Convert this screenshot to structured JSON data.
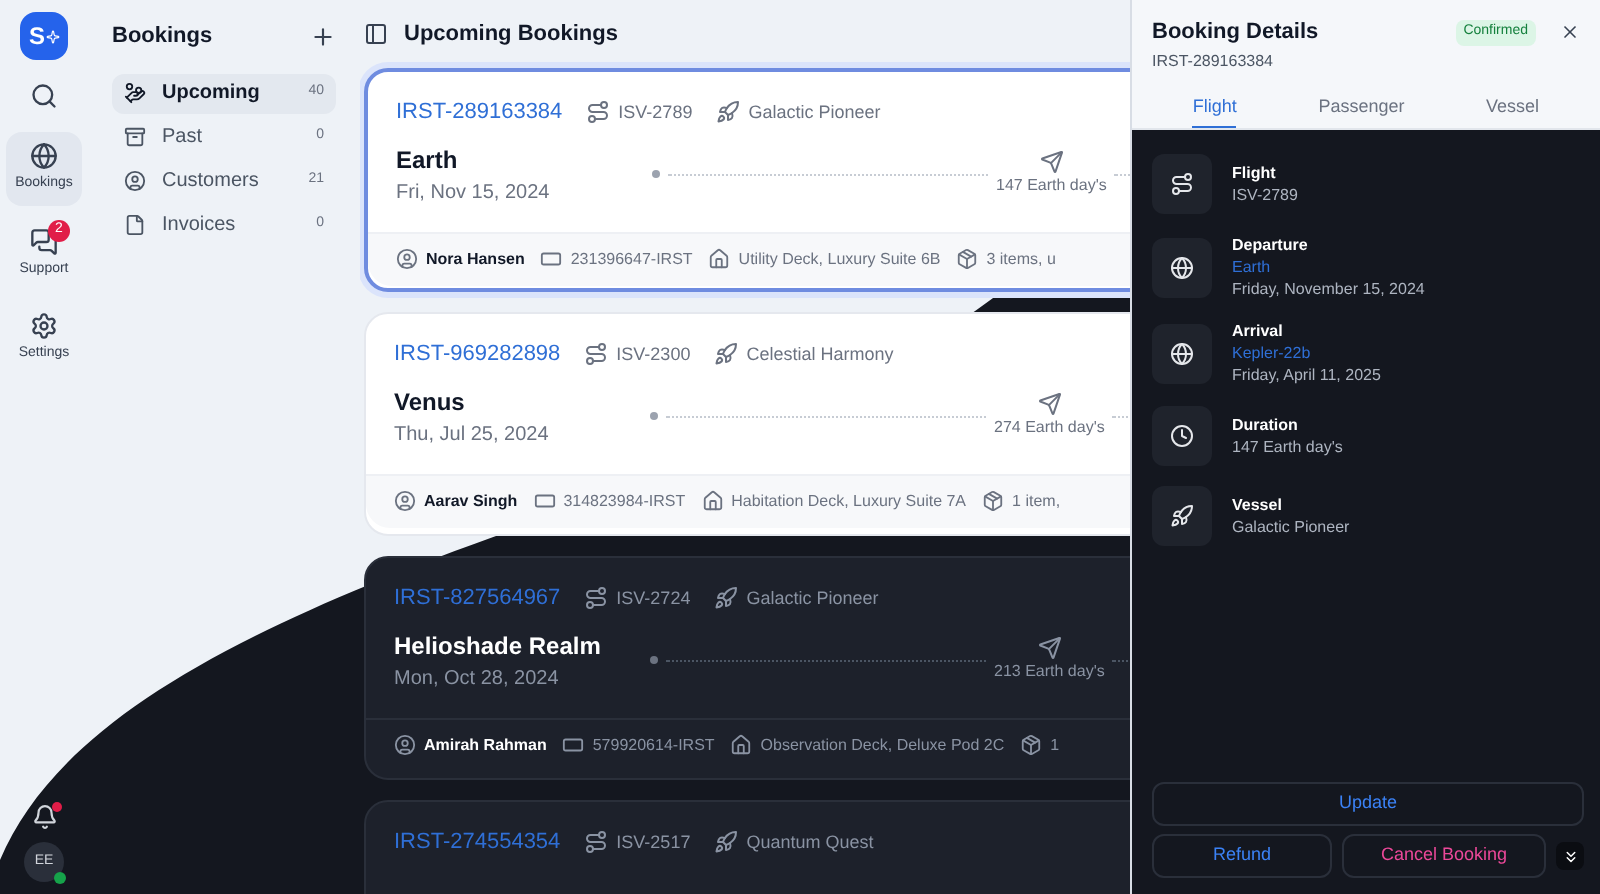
{
  "rail": {
    "logo": "S",
    "items": [
      {
        "kind": "search",
        "selected": false
      },
      {
        "label": "Bookings",
        "kind": "globe",
        "selected": true
      },
      {
        "label": "Support",
        "kind": "chat",
        "selected": false,
        "badge": "2"
      },
      {
        "label": "Settings",
        "kind": "gear",
        "selected": false
      }
    ],
    "avatar": "EE"
  },
  "bookings_panel": {
    "title": "Bookings",
    "items": [
      {
        "label": "Upcoming",
        "count": "40",
        "kind": "upcoming",
        "selected": true
      },
      {
        "label": "Past",
        "count": "0",
        "kind": "past",
        "selected": false
      },
      {
        "label": "Customers",
        "count": "21",
        "kind": "customers",
        "selected": false
      },
      {
        "label": "Invoices",
        "count": "0",
        "kind": "invoices",
        "selected": false
      }
    ]
  },
  "main": {
    "title": "Upcoming Bookings",
    "cards": [
      {
        "id": "IRST-289163384",
        "flight": "ISV-2789",
        "vessel": "Galactic Pioneer",
        "destination": "Earth",
        "date": "Fri, Nov 15, 2024",
        "duration": "147 Earth day's",
        "passenger": "Nora Hansen",
        "ticket": "231396647-IRST",
        "cabin": "Utility Deck, Luxury Suite 6B",
        "items": "3 items, u",
        "kind": "light",
        "selected": true
      },
      {
        "id": "IRST-969282898",
        "flight": "ISV-2300",
        "vessel": "Celestial Harmony",
        "destination": "Venus",
        "date": "Thu, Jul 25, 2024",
        "duration": "274 Earth day's",
        "passenger": "Aarav Singh",
        "ticket": "314823984-IRST",
        "cabin": "Habitation Deck, Luxury Suite 7A",
        "items": "1 item,",
        "kind": "light",
        "selected": false
      },
      {
        "id": "IRST-827564967",
        "flight": "ISV-2724",
        "vessel": "Galactic Pioneer",
        "destination": "Helioshade Realm",
        "date": "Mon, Oct 28, 2024",
        "duration": "213 Earth day's",
        "passenger": "Amirah Rahman",
        "ticket": "579920614-IRST",
        "cabin": "Observation Deck, Deluxe Pod 2C",
        "items": "1",
        "kind": "dark",
        "selected": false
      },
      {
        "id": "IRST-274554354",
        "flight": "ISV-2517",
        "vessel": "Quantum Quest",
        "kind": "dark",
        "selected": false
      }
    ]
  },
  "details": {
    "title": "Booking Details",
    "id": "IRST-289163384",
    "status": "Confirmed",
    "tabs": [
      {
        "label": "Flight",
        "selected": true
      },
      {
        "label": "Passenger",
        "selected": false
      },
      {
        "label": "Vessel",
        "selected": false
      }
    ],
    "rows": [
      {
        "kind": "route",
        "label": "Flight",
        "value": "ISV-2789"
      },
      {
        "kind": "globe",
        "label": "Departure",
        "link": "Earth",
        "value": "Friday, November 15, 2024"
      },
      {
        "kind": "globe",
        "label": "Arrival",
        "link": "Kepler-22b",
        "value": "Friday, April 11, 2025"
      },
      {
        "kind": "clock",
        "label": "Duration",
        "value": "147 Earth day's"
      },
      {
        "kind": "rocket",
        "label": "Vessel",
        "value": "Galactic Pioneer"
      }
    ],
    "buttons": {
      "update": "Update",
      "refund": "Refund",
      "cancel": "Cancel Booking"
    }
  }
}
